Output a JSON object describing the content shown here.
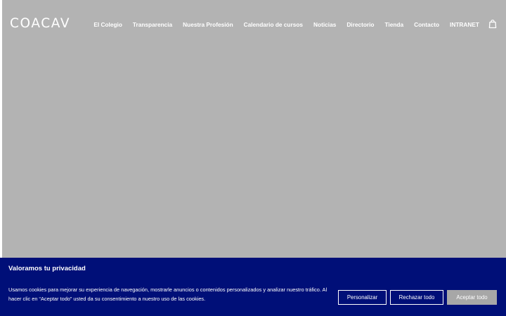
{
  "header": {
    "logo": "COACAV",
    "nav": [
      {
        "label": "El Colegio"
      },
      {
        "label": "Transparencia"
      },
      {
        "label": "Nuestra Profesión"
      },
      {
        "label": "Calendario de cursos"
      },
      {
        "label": "Noticias"
      },
      {
        "label": "Directorio"
      },
      {
        "label": "Tienda"
      },
      {
        "label": "Contacto"
      },
      {
        "label": "INTRANET"
      }
    ],
    "cart_icon": "shopping-bag-icon"
  },
  "cookie_banner": {
    "title": "Valoramos tu privacidad",
    "text": "Usamos cookies para mejorar su experiencia de navegación, mostrarle anuncios o contenidos personalizados y analizar nuestro tráfico. Al hacer clic en “Aceptar todo” usted da su consentimiento a nuestro uso de las cookies.",
    "customize_label": "Personalizar",
    "reject_label": "Rechazar todo",
    "accept_label": "Aceptar todo"
  },
  "colors": {
    "hero_background": "#b3b3b3",
    "banner_background": "#000f78",
    "accept_button": "#a7a7a7",
    "text": "#ffffff"
  }
}
